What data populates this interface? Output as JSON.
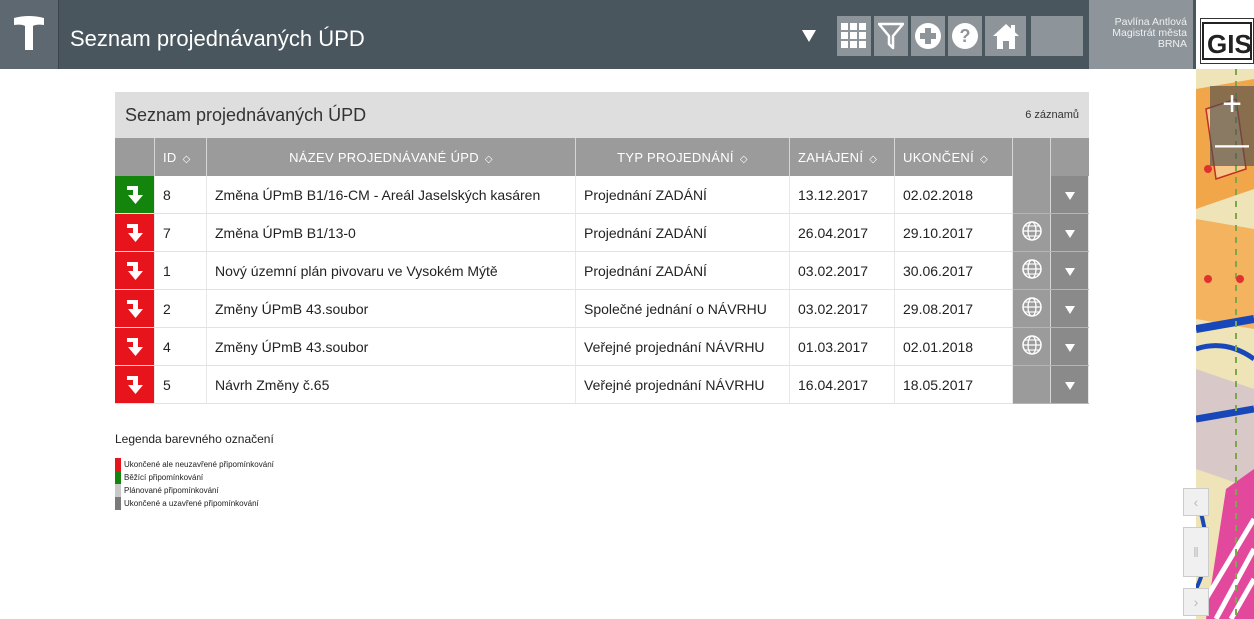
{
  "header": {
    "title": "Seznam projednávaných ÚPD",
    "user_name": "Pavlína Antlová",
    "user_org1": "Magistrát města",
    "user_org2": "BRNA",
    "toolbar": [
      "grid-icon",
      "filter-icon",
      "plus-circle-icon",
      "help-icon",
      "home-icon"
    ]
  },
  "panel": {
    "title": "Seznam projednávaných ÚPD",
    "count": "6 záznamů"
  },
  "table": {
    "columns": {
      "id": "ID",
      "name": "NÁZEV PROJEDNÁVANÉ ÚPD",
      "type": "TYP PROJEDNÁNÍ",
      "start": "ZAHÁJENÍ",
      "end": "UKONČENÍ"
    },
    "sort_symbol": "◇",
    "rows": [
      {
        "status": "green",
        "id": "8",
        "name": "Změna ÚPmB B1/16-CM - Areál Jaselských kasáren",
        "type": "Projednání ZADÁNÍ",
        "start": "13.12.2017",
        "end": "02.02.2018",
        "globe": false
      },
      {
        "status": "red",
        "id": "7",
        "name": "Změna ÚPmB B1/13-0",
        "type": "Projednání ZADÁNÍ",
        "start": "26.04.2017",
        "end": "29.10.2017",
        "globe": true
      },
      {
        "status": "red",
        "id": "1",
        "name": "Nový územní plán pivovaru ve Vysokém Mýtě",
        "type": "Projednání ZADÁNÍ",
        "start": "03.02.2017",
        "end": "30.06.2017",
        "globe": true
      },
      {
        "status": "red",
        "id": "2",
        "name": "Změny ÚPmB 43.soubor",
        "type": "Společné jednání o NÁVRHU",
        "start": "03.02.2017",
        "end": "29.08.2017",
        "globe": true
      },
      {
        "status": "red",
        "id": "4",
        "name": "Změny ÚPmB 43.soubor",
        "type": "Veřejné projednání NÁVRHU",
        "start": "01.03.2017",
        "end": "02.01.2018",
        "globe": true
      },
      {
        "status": "red",
        "id": "5",
        "name": "Návrh Změny č.65",
        "type": "Veřejné projednání NÁVRHU",
        "start": "16.04.2017",
        "end": "18.05.2017",
        "globe": false
      }
    ]
  },
  "legend": {
    "title": "Legenda barevného označení",
    "items": [
      {
        "color": "#e8141b",
        "label": "Ukončené ale neuzavřené připomínkování"
      },
      {
        "color": "#13850d",
        "label": "Běžící připomínkování"
      },
      {
        "color": "#c8c8c8",
        "label": "Plánované připomínkování"
      },
      {
        "color": "#7a7a7a",
        "label": "Ukončené a uzavřené připomínkování"
      }
    ]
  },
  "colors": {
    "header_bg": "#4a565e",
    "status_red": "#e8141b",
    "status_green": "#13850d"
  },
  "map": {
    "zoom_in": "+",
    "zoom_out": "—"
  }
}
